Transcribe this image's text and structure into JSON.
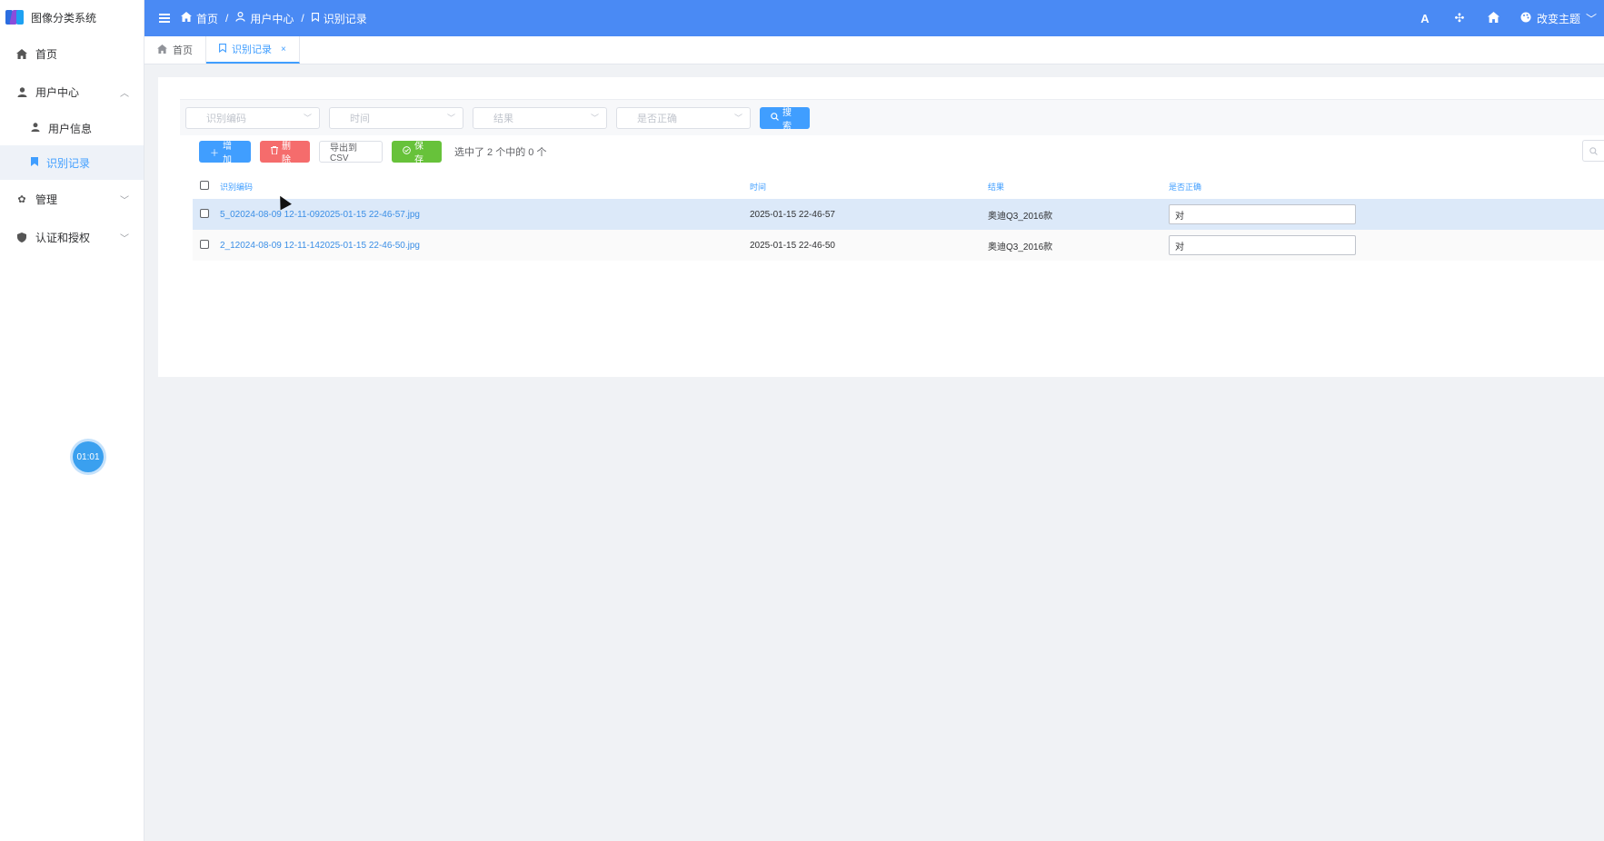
{
  "app": {
    "title": "图像分类系统",
    "timer": "01:01"
  },
  "sidebar": {
    "items": [
      {
        "label": "首页",
        "icon": "home-icon"
      },
      {
        "label": "用户中心",
        "icon": "user-icon",
        "expanded": true
      },
      {
        "label": "用户信息",
        "icon": "user-icon"
      },
      {
        "label": "识别记录",
        "icon": "bookmark-icon",
        "active": true
      },
      {
        "label": "管理",
        "icon": "gear-icon"
      },
      {
        "label": "认证和授权",
        "icon": "shield-icon"
      }
    ]
  },
  "header": {
    "breadcrumb": [
      "首页",
      "用户中心",
      "识别记录"
    ],
    "separator": "/",
    "theme_label": "改变主题",
    "icons": [
      "font-size-icon",
      "fullscreen-icon",
      "home-icon",
      "palette-icon"
    ],
    "accent": "#4a8af4"
  },
  "tabs": [
    {
      "label": "首页",
      "active": false
    },
    {
      "label": "识别记录",
      "active": true,
      "close": "×"
    }
  ],
  "filters": {
    "placeholders": [
      "识别编码",
      "时间",
      "结果",
      "是否正确"
    ],
    "search_label": "搜索"
  },
  "toolbar": {
    "add_label": "增加",
    "delete_label": "删除",
    "export_label": "导出到CSV",
    "save_label": "保存",
    "selection_text": "选中了 2 个中的 0 个"
  },
  "table": {
    "headers": [
      "识别编码",
      "时间",
      "结果",
      "是否正确"
    ],
    "rows": [
      {
        "code": "5_02024-08-09 12-11-092025-01-15 22-46-57.jpg",
        "time": "2025-01-15 22-46-57",
        "result": "奥迪Q3_2016款",
        "correct": "对"
      },
      {
        "code": "2_12024-08-09 12-11-142025-01-15 22-46-50.jpg",
        "time": "2025-01-15 22-46-50",
        "result": "奥迪Q3_2016款",
        "correct": "对"
      }
    ]
  }
}
